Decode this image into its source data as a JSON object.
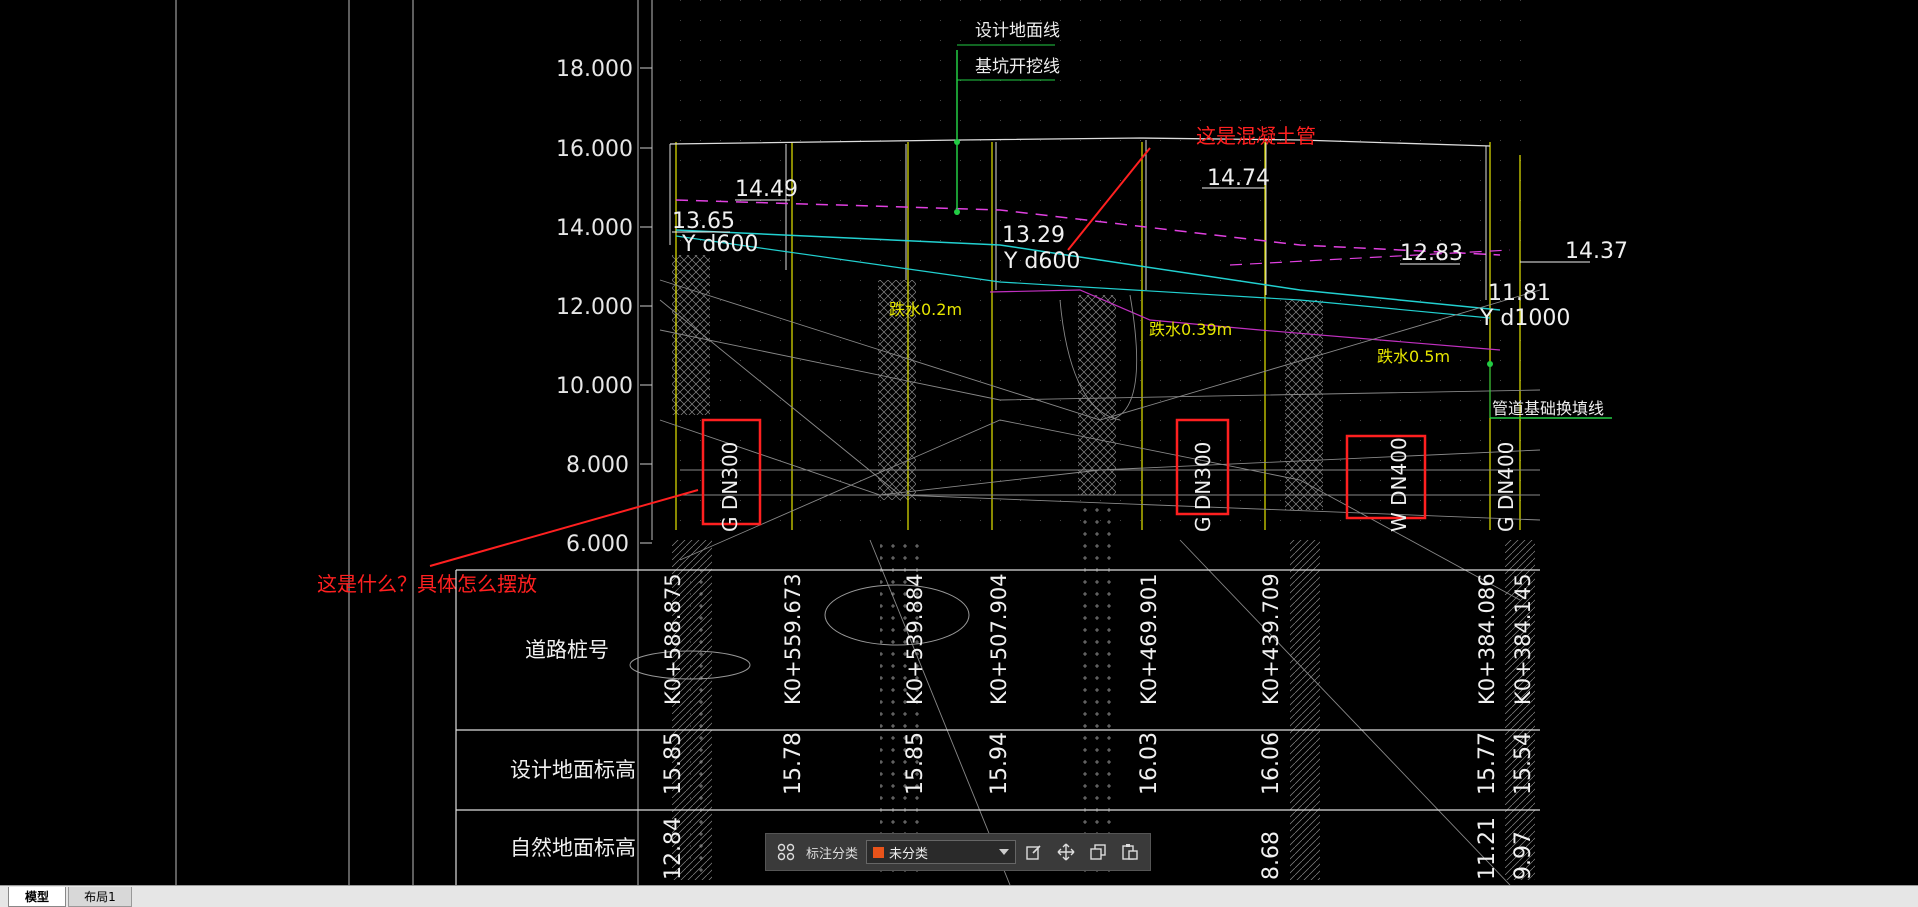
{
  "elevation_labels": [
    "18.000",
    "16.000",
    "14.000",
    "12.000",
    "10.000",
    "8.000",
    "6.000"
  ],
  "top_notes": {
    "design_ground_line": "设计地面线",
    "pit_excavation_line": "基坑开挖线"
  },
  "annotations": {
    "concrete_pipe": "这是混凝土管",
    "what_is_this": "这是什么？具体怎么摆放"
  },
  "pipe_labels": {
    "dn300_left": "G DN300",
    "dn300_mid": "G DN300",
    "dn400": "W DN400",
    "dn400_right": "G DN400",
    "y_d600_left": "Y d600",
    "y_d600_mid": "Y d600",
    "y_d1000": "Y d1000"
  },
  "elevation_marks": {
    "e1449": "14.49",
    "e1365": "13.65",
    "e1329": "13.29",
    "e1474": "14.74",
    "e1283": "12.83",
    "e1437": "14.37",
    "e1181": "11.81"
  },
  "drop_labels": {
    "d02": "跌水0.2m",
    "d039": "跌水0.39m",
    "d05": "跌水0.5m"
  },
  "pipe_base_line": "管道基础换填线",
  "table_rows": {
    "station": "道路桩号",
    "design_ground": "设计地面标高",
    "natural_ground": "自然地面标高"
  },
  "stations": [
    "K0+588.875",
    "K0+559.673",
    "K0+539.884",
    "K0+507.904",
    "K0+469.901",
    "K0+439.709",
    "K0+384.086",
    "K0+384.145"
  ],
  "design_elev": [
    "15.85",
    "15.78",
    "15.85",
    "15.94",
    "16.03",
    "16.06",
    "15.77",
    "15.54"
  ],
  "natural_elev": [
    "12.84",
    "8.68",
    "11.21",
    "9.97"
  ],
  "toolbar": {
    "label": "标注分类",
    "selected": "未分类",
    "swatch_color": "#e8531a"
  },
  "tabs": {
    "model": "模型",
    "layout1": "布局1"
  }
}
